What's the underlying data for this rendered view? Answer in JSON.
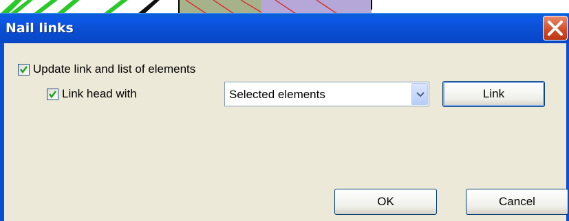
{
  "dialog": {
    "title": "Nail links",
    "close_icon": "close-icon"
  },
  "options": {
    "update_link": {
      "label": "Update link and list of elements",
      "checked": true
    },
    "link_head": {
      "label": "Link head with",
      "checked": true
    }
  },
  "link_target": {
    "selected": "Selected elements"
  },
  "buttons": {
    "link": "Link",
    "ok": "OK",
    "cancel": "Cancel"
  },
  "colors": {
    "titlebar": "#0a4fd4",
    "dialog_bg": "#ece9d8",
    "check": "#21a121"
  }
}
